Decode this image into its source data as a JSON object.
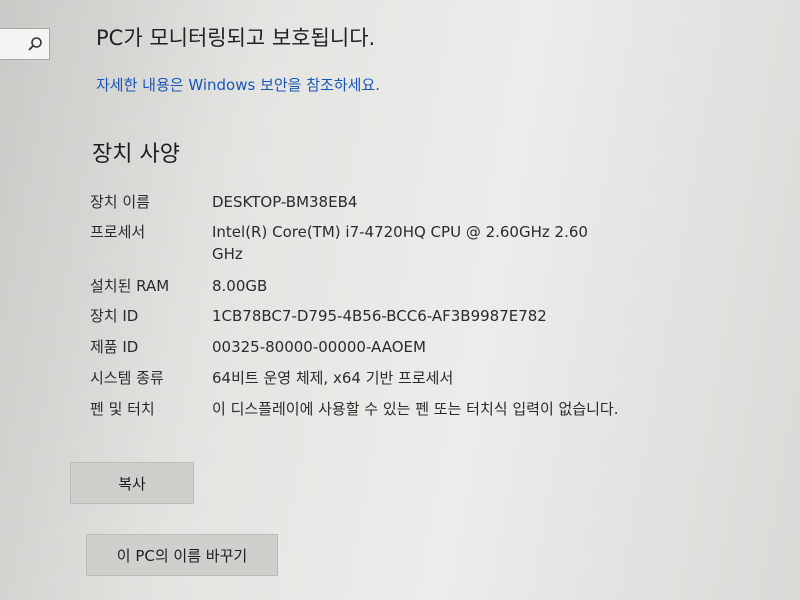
{
  "banner": {
    "title": "PC가 모니터링되고 보호됩니다.",
    "link": "자세한 내용은 Windows 보안을 참조하세요."
  },
  "section": {
    "title": "장치 사양"
  },
  "specs": [
    {
      "label": "장치 이름",
      "value": "DESKTOP-BM38EB4"
    },
    {
      "label": "프로세서",
      "value": "Intel(R) Core(TM) i7-4720HQ CPU @ 2.60GHz   2.60 GHz"
    },
    {
      "label": "설치된 RAM",
      "value": "8.00GB"
    },
    {
      "label": "장치 ID",
      "value": "1CB78BC7-D795-4B56-BCC6-AF3B9987E782"
    },
    {
      "label": "제품 ID",
      "value": "00325-80000-00000-AAOEM"
    },
    {
      "label": "시스템 종류",
      "value": "64비트 운영 체제, x64 기반 프로세서"
    },
    {
      "label": "펜 및 터치",
      "value": "이 디스플레이에 사용할 수 있는 펜 또는 터치식 입력이 없습니다."
    }
  ],
  "buttons": {
    "copy": "복사",
    "rename": "이 PC의 이름 바꾸기"
  },
  "icons": {
    "search": "search-icon"
  },
  "colors": {
    "link": "#1a56b8",
    "button": "#cfcfcc"
  }
}
